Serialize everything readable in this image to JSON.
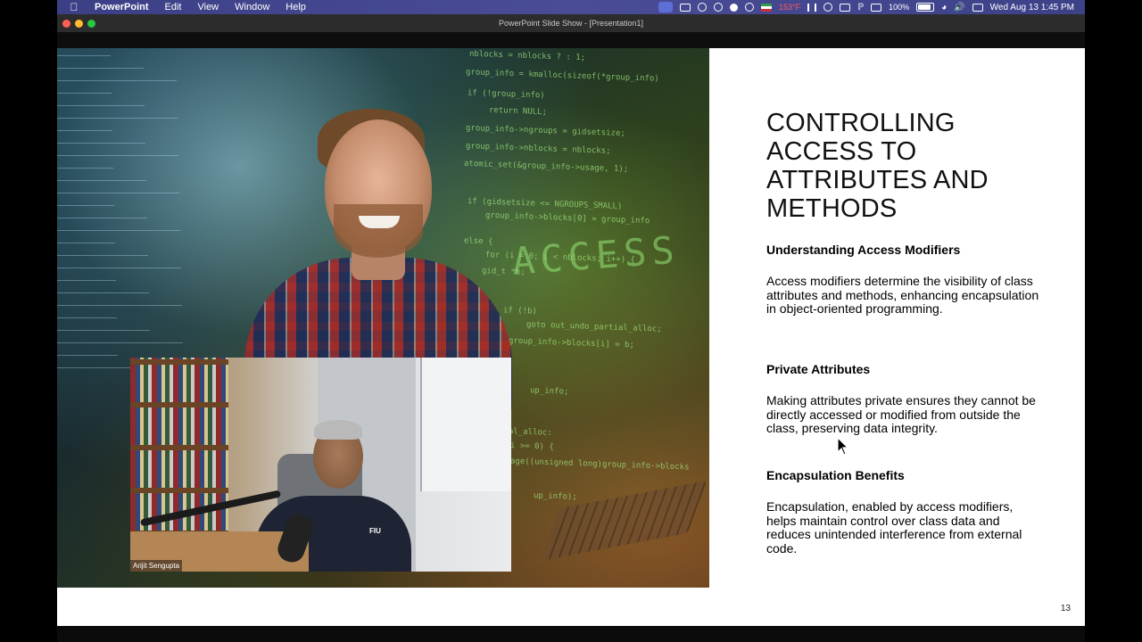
{
  "menubar": {
    "app_name": "PowerPoint",
    "menus": [
      "Edit",
      "View",
      "Window",
      "Help"
    ],
    "status_temp": "153°F",
    "battery": "100%",
    "datetime": "Wed Aug 13  1:45 PM"
  },
  "window": {
    "title": "PowerPoint Slide Show - [Presentation1]"
  },
  "slide": {
    "title": "CONTROLLING ACCESS TO ATTRIBUTES AND METHODS",
    "sections": [
      {
        "heading": "Understanding Access Modifiers",
        "body": "Access modifiers determine the visibility of class attributes and methods, enhancing encapsulation in object-oriented programming."
      },
      {
        "heading": "Private Attributes",
        "body": "Making attributes private ensures they cannot be directly accessed or modified from outside the class, preserving data integrity."
      },
      {
        "heading": "Encapsulation Benefits",
        "body": "Encapsulation, enabled by access modifiers, helps maintain control over class data and reduces unintended interference from external code."
      }
    ],
    "page_number": "13",
    "hero_image": {
      "access_word": "ACCESS",
      "code_lines": [
        "nblocks = nblocks ? : 1;",
        "group_info = kmalloc(sizeof(*group_info)",
        "if (!group_info)",
        "return NULL;",
        "group_info->ngroups = gidsetsize;",
        "group_info->nblocks = nblocks;",
        "atomic_set(&group_info->usage, 1);",
        "if (gidsetsize <= NGROUPS_SMALL)",
        "group_info->blocks[0] = group_info",
        "else {",
        "for (i = 0; i < nblocks; i++) {",
        "gid_t *b;",
        "if (!b)",
        "goto out_undo_partial_alloc;",
        "group_info->blocks[i] = b;",
        "up_info;",
        "al_alloc:",
        "i >= 0) {",
        "age((unsigned long)group_info->blocks",
        "up_info);"
      ]
    }
  },
  "webcam": {
    "participant_name": "Arijit Sengupta",
    "shirt_logo": "FIU"
  }
}
